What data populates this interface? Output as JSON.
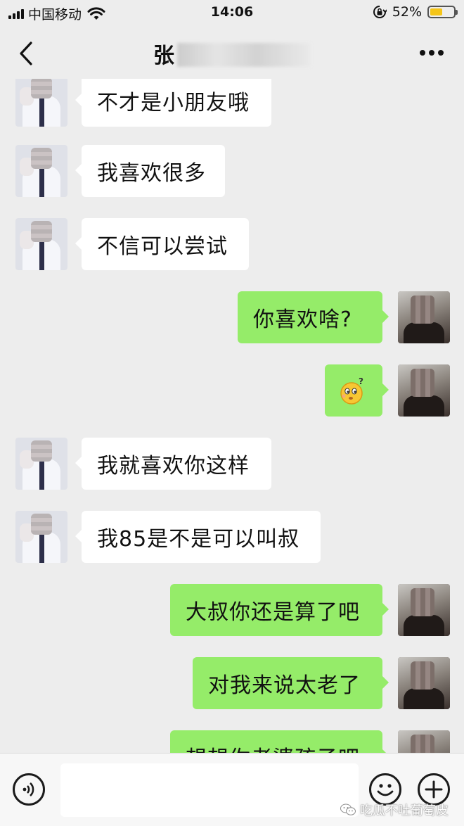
{
  "status_bar": {
    "carrier": "中国移动",
    "time": "14:06",
    "battery_percent": "52%",
    "battery_level": 0.52,
    "icons": [
      "signal-icon",
      "wifi-icon",
      "rotation-lock-icon",
      "battery-icon"
    ]
  },
  "nav": {
    "title_visible": "张",
    "icons": [
      "back-arrow-icon",
      "more-icon"
    ]
  },
  "messages": [
    {
      "side": "left",
      "text": "不才是小朋友哦"
    },
    {
      "side": "left",
      "text": "我喜欢很多"
    },
    {
      "side": "left",
      "text": "不信可以尝试"
    },
    {
      "side": "right",
      "text": "你喜欢啥?"
    },
    {
      "side": "right",
      "type": "emoji",
      "icon": "confused-face-emoji-icon"
    },
    {
      "side": "left",
      "text": "我就喜欢你这样"
    },
    {
      "side": "left",
      "text": "我85是不是可以叫叔"
    },
    {
      "side": "right",
      "text": "大叔你还是算了吧"
    },
    {
      "side": "right",
      "text": "对我来说太老了"
    },
    {
      "side": "right",
      "text": "想想你老婆孩子吧"
    }
  ],
  "input_bar": {
    "message_value": "",
    "icons": [
      "voice-icon",
      "emoji-icon",
      "plus-icon"
    ]
  },
  "watermark": {
    "text": "吃瓜不吐葡萄皮",
    "icon": "wechat-logo-icon"
  },
  "colors": {
    "background": "#ededed",
    "incoming_bubble": "#ffffff",
    "outgoing_bubble": "#95ec69",
    "battery": "#f5c518"
  }
}
